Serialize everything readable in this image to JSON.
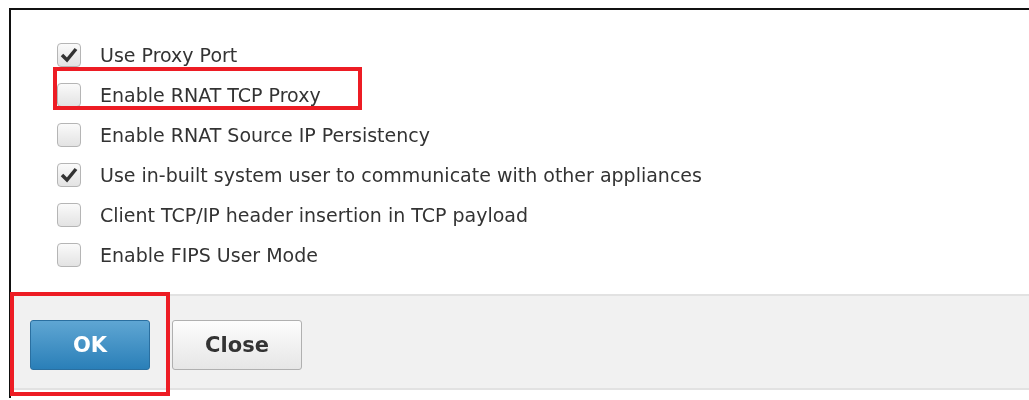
{
  "options": [
    {
      "label": "Use Proxy Port",
      "checked": true,
      "highlighted": false
    },
    {
      "label": "Enable RNAT TCP Proxy",
      "checked": false,
      "highlighted": true
    },
    {
      "label": "Enable RNAT Source IP Persistency",
      "checked": false,
      "highlighted": false
    },
    {
      "label": "Use in-built system user to communicate with other appliances",
      "checked": true,
      "highlighted": false
    },
    {
      "label": "Client TCP/IP header insertion in TCP payload",
      "checked": false,
      "highlighted": false
    },
    {
      "label": "Enable FIPS User Mode",
      "checked": false,
      "highlighted": false
    }
  ],
  "buttons": [
    {
      "label": "OK",
      "kind": "primary",
      "highlighted": true
    },
    {
      "label": "Close",
      "kind": "secondary",
      "highlighted": false
    }
  ]
}
